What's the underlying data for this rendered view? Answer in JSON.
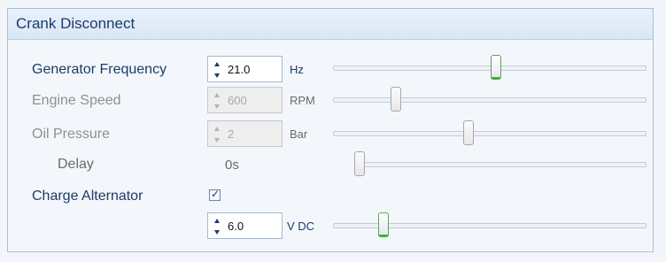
{
  "panel": {
    "title": "Crank Disconnect"
  },
  "rows": {
    "generator_frequency": {
      "label": "Generator Frequency",
      "value": "21.0",
      "unit": "Hz",
      "slider_level": 0.52,
      "enabled": true
    },
    "engine_speed": {
      "label": "Engine Speed",
      "value": "600",
      "unit": "RPM",
      "slider_level": 0.19,
      "enabled": false
    },
    "oil_pressure": {
      "label": "Oil Pressure",
      "value": "2",
      "unit": "Bar",
      "slider_level": 0.43,
      "enabled": false
    },
    "delay": {
      "label": "Delay",
      "value": "0s",
      "slider_level": 0.0
    },
    "charge_alternator": {
      "label": "Charge Alternator",
      "checked": true,
      "value": "6.0",
      "unit": "V DC",
      "slider_level": 0.15
    }
  },
  "colors": {
    "accent": "#1d3b66",
    "thumb_active": "#43b037",
    "disabled_text": "#a8a8a8"
  }
}
